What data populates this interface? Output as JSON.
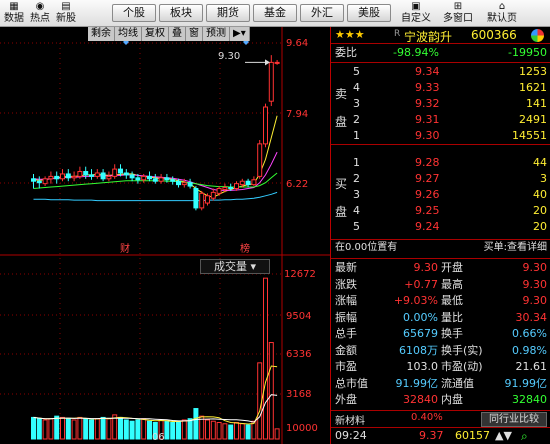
{
  "toolbar": {
    "left_tools": [
      {
        "label": "数据",
        "icon": "data-icon"
      },
      {
        "label": "热点",
        "icon": "hotspot-icon"
      },
      {
        "label": "新股",
        "icon": "new-stock-icon"
      }
    ],
    "market_buttons": [
      "个股",
      "板块",
      "期货",
      "基金",
      "外汇",
      "美股"
    ],
    "right_tools": [
      {
        "label": "自定义",
        "icon": "custom-icon"
      },
      {
        "label": "多窗口",
        "icon": "multiwindow-icon"
      },
      {
        "label": "默认页",
        "icon": "default-page-icon"
      }
    ]
  },
  "chart": {
    "tool_tabs": [
      "剩余",
      "均线",
      "复权",
      "叠",
      "窗",
      "预测"
    ],
    "price_axis": [
      "9.64",
      "7.94",
      "6.22"
    ],
    "last_price_tag": "9.30",
    "event_marks": {
      "cai": "财",
      "bang": "榜"
    },
    "volume_title": "成交量",
    "volume_axis": [
      "12672",
      "9504",
      "6336",
      "3168",
      "10000"
    ],
    "x_label": "06",
    "candles": [
      {
        "o": 6.9,
        "c": 6.85,
        "h": 7.0,
        "l": 6.7,
        "v": 1700
      },
      {
        "o": 6.85,
        "c": 6.82,
        "h": 6.95,
        "l": 6.7,
        "v": 1600
      },
      {
        "o": 6.8,
        "c": 6.9,
        "h": 6.95,
        "l": 6.75,
        "v": 1500
      },
      {
        "o": 6.9,
        "c": 6.95,
        "h": 7.05,
        "l": 6.8,
        "v": 1600
      },
      {
        "o": 6.95,
        "c": 6.9,
        "h": 7.05,
        "l": 6.8,
        "v": 1800
      },
      {
        "o": 6.9,
        "c": 7.0,
        "h": 7.1,
        "l": 6.85,
        "v": 1700
      },
      {
        "o": 7.0,
        "c": 6.92,
        "h": 7.1,
        "l": 6.85,
        "v": 1600
      },
      {
        "o": 6.92,
        "c": 6.95,
        "h": 7.05,
        "l": 6.85,
        "v": 1500
      },
      {
        "o": 6.95,
        "c": 7.05,
        "h": 7.15,
        "l": 6.9,
        "v": 1700
      },
      {
        "o": 7.05,
        "c": 6.98,
        "h": 7.15,
        "l": 6.9,
        "v": 1600
      },
      {
        "o": 6.98,
        "c": 6.95,
        "h": 7.1,
        "l": 6.88,
        "v": 1500
      },
      {
        "o": 6.95,
        "c": 7.02,
        "h": 7.1,
        "l": 6.9,
        "v": 1600
      },
      {
        "o": 7.02,
        "c": 6.9,
        "h": 7.1,
        "l": 6.85,
        "v": 1700
      },
      {
        "o": 6.9,
        "c": 6.95,
        "h": 7.05,
        "l": 6.85,
        "v": 1600
      },
      {
        "o": 6.95,
        "c": 7.1,
        "h": 7.2,
        "l": 6.9,
        "v": 1900
      },
      {
        "o": 7.1,
        "c": 7.02,
        "h": 7.2,
        "l": 6.95,
        "v": 1700
      },
      {
        "o": 7.02,
        "c": 6.98,
        "h": 7.1,
        "l": 6.9,
        "v": 1500
      },
      {
        "o": 6.98,
        "c": 6.92,
        "h": 7.05,
        "l": 6.85,
        "v": 1400
      },
      {
        "o": 6.92,
        "c": 6.88,
        "h": 7.0,
        "l": 6.8,
        "v": 1500
      },
      {
        "o": 6.88,
        "c": 6.95,
        "h": 7.0,
        "l": 6.82,
        "v": 1600
      },
      {
        "o": 6.95,
        "c": 6.9,
        "h": 7.05,
        "l": 6.85,
        "v": 1400
      },
      {
        "o": 6.9,
        "c": 6.85,
        "h": 7.0,
        "l": 6.8,
        "v": 1300
      },
      {
        "o": 6.85,
        "c": 6.92,
        "h": 7.0,
        "l": 6.8,
        "v": 1500
      },
      {
        "o": 6.92,
        "c": 6.88,
        "h": 7.0,
        "l": 6.82,
        "v": 1400
      },
      {
        "o": 6.88,
        "c": 6.85,
        "h": 6.95,
        "l": 6.78,
        "v": 1300
      },
      {
        "o": 6.85,
        "c": 6.78,
        "h": 6.9,
        "l": 6.72,
        "v": 1400
      },
      {
        "o": 6.78,
        "c": 6.82,
        "h": 6.9,
        "l": 6.72,
        "v": 1500
      },
      {
        "o": 6.82,
        "c": 6.75,
        "h": 6.9,
        "l": 6.7,
        "v": 1600
      },
      {
        "o": 6.7,
        "c": 6.3,
        "h": 6.75,
        "l": 6.25,
        "v": 2400
      },
      {
        "o": 6.3,
        "c": 6.6,
        "h": 6.65,
        "l": 6.25,
        "v": 1800
      },
      {
        "o": 6.4,
        "c": 6.55,
        "h": 6.6,
        "l": 6.35,
        "v": 1500
      },
      {
        "o": 6.5,
        "c": 6.62,
        "h": 6.7,
        "l": 6.45,
        "v": 1400
      },
      {
        "o": 6.6,
        "c": 6.7,
        "h": 6.75,
        "l": 6.55,
        "v": 1300
      },
      {
        "o": 6.68,
        "c": 6.72,
        "h": 6.8,
        "l": 6.62,
        "v": 1200
      },
      {
        "o": 6.72,
        "c": 6.7,
        "h": 6.8,
        "l": 6.65,
        "v": 1100
      },
      {
        "o": 6.7,
        "c": 6.8,
        "h": 6.85,
        "l": 6.65,
        "v": 1300
      },
      {
        "o": 6.78,
        "c": 6.85,
        "h": 6.9,
        "l": 6.72,
        "v": 1200
      },
      {
        "o": 6.85,
        "c": 6.78,
        "h": 6.9,
        "l": 6.72,
        "v": 1100
      },
      {
        "o": 6.78,
        "c": 6.88,
        "h": 6.95,
        "l": 6.75,
        "v": 1400
      },
      {
        "o": 6.95,
        "c": 7.62,
        "h": 7.7,
        "l": 6.9,
        "v": 6000
      },
      {
        "o": 7.62,
        "c": 8.38,
        "h": 8.45,
        "l": 7.55,
        "v": 12672
      },
      {
        "o": 8.5,
        "c": 9.3,
        "h": 9.45,
        "l": 8.4,
        "v": 7600
      },
      {
        "o": 9.3,
        "c": 9.3,
        "h": 9.35,
        "l": 9.25,
        "v": 800
      }
    ],
    "ma_lines": [
      {
        "name": "ma5",
        "color": "#ffee33",
        "values": [
          6.88,
          6.87,
          6.88,
          6.9,
          6.92,
          6.94,
          6.95,
          6.95,
          6.96,
          6.98,
          6.98,
          6.99,
          6.98,
          6.97,
          6.98,
          6.99,
          7.0,
          7.0,
          6.97,
          6.95,
          6.93,
          6.92,
          6.9,
          6.9,
          6.89,
          6.86,
          6.84,
          6.8,
          6.7,
          6.62,
          6.55,
          6.52,
          6.58,
          6.64,
          6.68,
          6.72,
          6.75,
          6.78,
          6.8,
          7.0,
          7.3,
          7.75,
          8.2
        ]
      },
      {
        "name": "ma10",
        "color": "#ff44ff",
        "values": [
          6.9,
          6.89,
          6.89,
          6.9,
          6.91,
          6.92,
          6.93,
          6.93,
          6.94,
          6.95,
          6.95,
          6.96,
          6.96,
          6.96,
          6.97,
          6.97,
          6.98,
          6.98,
          6.97,
          6.96,
          6.95,
          6.94,
          6.93,
          6.92,
          6.91,
          6.89,
          6.87,
          6.84,
          6.8,
          6.76,
          6.72,
          6.68,
          6.66,
          6.66,
          6.66,
          6.67,
          6.68,
          6.7,
          6.72,
          6.82,
          6.98,
          7.2,
          7.45
        ]
      },
      {
        "name": "ma20",
        "color": "#33ff33",
        "values": [
          6.7,
          6.71,
          6.72,
          6.73,
          6.74,
          6.75,
          6.76,
          6.77,
          6.78,
          6.79,
          6.8,
          6.81,
          6.82,
          6.83,
          6.84,
          6.85,
          6.86,
          6.86,
          6.86,
          6.86,
          6.86,
          6.86,
          6.86,
          6.85,
          6.85,
          6.84,
          6.83,
          6.82,
          6.8,
          6.78,
          6.76,
          6.75,
          6.74,
          6.74,
          6.73,
          6.73,
          6.73,
          6.73,
          6.73,
          6.76,
          6.82,
          6.92,
          7.02
        ]
      },
      {
        "name": "ma60",
        "color": "#33ccff",
        "values": [
          6.48,
          6.48,
          6.48,
          6.47,
          6.47,
          6.47,
          6.47,
          6.46,
          6.46,
          6.46,
          6.46,
          6.45,
          6.45,
          6.45,
          6.45,
          6.45,
          6.45,
          6.45,
          6.45,
          6.45,
          6.45,
          6.45,
          6.45,
          6.45,
          6.45,
          6.45,
          6.45,
          6.45,
          6.45,
          6.45,
          6.46,
          6.46,
          6.46,
          6.47,
          6.47,
          6.48,
          6.48,
          6.49,
          6.5,
          6.52,
          6.55,
          6.58,
          6.62
        ]
      }
    ]
  },
  "quote": {
    "stars": "★★★",
    "rmark": "R",
    "name": "宁波韵升",
    "code": "600366",
    "weibi_label": "委比",
    "weibi_pct": "-98.94%",
    "weibi_val": "-19950",
    "sell_side_label": [
      "卖",
      "盘"
    ],
    "buy_side_label": [
      "买",
      "盘"
    ],
    "asks": [
      {
        "level": "5",
        "price": "9.34",
        "vol": "1253"
      },
      {
        "level": "4",
        "price": "9.33",
        "vol": "1621"
      },
      {
        "level": "3",
        "price": "9.32",
        "vol": "141"
      },
      {
        "level": "2",
        "price": "9.31",
        "vol": "2491"
      },
      {
        "level": "1",
        "price": "9.30",
        "vol": "14551"
      }
    ],
    "bids": [
      {
        "level": "1",
        "price": "9.28",
        "vol": "44"
      },
      {
        "level": "2",
        "price": "9.27",
        "vol": "3"
      },
      {
        "level": "3",
        "price": "9.26",
        "vol": "40"
      },
      {
        "level": "4",
        "price": "9.25",
        "vol": "20"
      },
      {
        "level": "5",
        "price": "9.24",
        "vol": "20"
      }
    ],
    "position_note": "在0.00位置有",
    "buy1_note": "买单:查看详细",
    "stats": [
      {
        "l1": "最新",
        "v1": "9.30",
        "c1": "red",
        "l2": "开盘",
        "v2": "9.30",
        "c2": "red"
      },
      {
        "l1": "涨跌",
        "v1": "+0.77",
        "c1": "red",
        "l2": "最高",
        "v2": "9.30",
        "c2": "red"
      },
      {
        "l1": "涨幅",
        "v1": "+9.03%",
        "c1": "red",
        "l2": "最低",
        "v2": "9.30",
        "c2": "red"
      },
      {
        "l1": "振幅",
        "v1": "0.00%",
        "c1": "cyan",
        "l2": "量比",
        "v2": "30.34",
        "c2": "red"
      },
      {
        "l1": "总手",
        "v1": "65679",
        "c1": "cyan",
        "l2": "换手",
        "v2": "0.66%",
        "c2": "cyan"
      },
      {
        "l1": "金额",
        "v1": "6108万",
        "c1": "cyan",
        "l2": "换手(实)",
        "v2": "0.98%",
        "c2": "cyan"
      },
      {
        "l1": "市盈",
        "v1": "103.0",
        "c1": "white",
        "l2": "市盈(动)",
        "v2": "21.61",
        "c2": "white"
      },
      {
        "l1": "总市值",
        "v1": "91.99亿",
        "c1": "cyan",
        "l2": "流通值",
        "v2": "91.99亿",
        "c2": "cyan"
      },
      {
        "l1": "外盘",
        "v1": "32840",
        "c1": "red",
        "l2": "内盘",
        "v2": "32840",
        "c2": "green"
      }
    ],
    "sector": "新材料",
    "sector_pct": "0.40%",
    "peer_btn": "同行业比较",
    "tick": {
      "time": "09:24",
      "price": "9.37",
      "vol": "60157"
    }
  },
  "colors": {
    "up": "#ff3333",
    "down": "#33ffff",
    "grid": "#8b0000",
    "axis": "#b00000"
  }
}
